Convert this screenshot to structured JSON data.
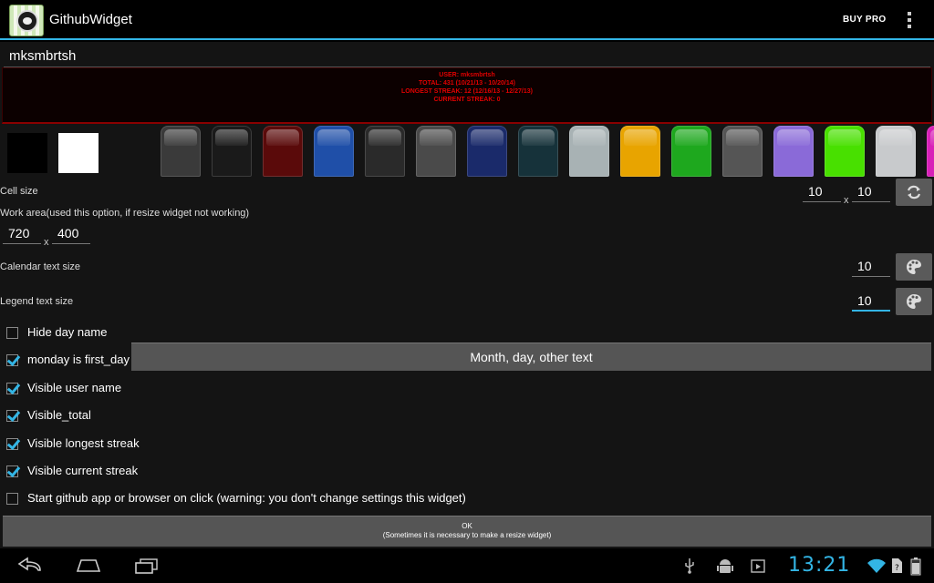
{
  "app": {
    "title": "GithubWidget",
    "buy_pro": "BUY PRO"
  },
  "username": "mksmbrtsh",
  "preview": {
    "user": "USER: mksmbrtsh",
    "total": "TOTAL: 431 (10/21/13 - 10/20/14)",
    "longest": "LONGEST STREAK: 12 (12/16/13 - 12/27/13)",
    "current": "CURRENT STREAK: 0"
  },
  "themes": [
    "#3a3a3a",
    "#1a1a1a",
    "#5a0a0a",
    "#1f4fa8",
    "#2a2a2a",
    "#4a4a4a",
    "#1a2a6a",
    "#16323a",
    "#a8b2b4",
    "#e8a400",
    "#1ea81e",
    "#555555",
    "#8a6ad8",
    "#48e000",
    "#c8cacc",
    "#d820b8"
  ],
  "cell_size": {
    "label": "Cell size",
    "width": "10",
    "x": "x",
    "height": "10"
  },
  "work_area": {
    "label": "Work area(used this option, if resize widget not working)",
    "width": "720",
    "x": "x",
    "height": "400"
  },
  "calendar_text": {
    "label": "Calendar text size",
    "value": "10"
  },
  "legend_text": {
    "label": "Legend text size",
    "value": "10"
  },
  "options": [
    {
      "label": "Hide day name",
      "checked": false
    },
    {
      "label": "monday is first_day",
      "checked": true
    },
    {
      "label": "Visible user name",
      "checked": true
    },
    {
      "label": "Visible_total",
      "checked": true
    },
    {
      "label": "Visible longest streak",
      "checked": true
    },
    {
      "label": "Visible current streak",
      "checked": true
    },
    {
      "label": "Start github app or browser on click (warning: you don't change settings this widget)",
      "checked": false
    }
  ],
  "month_button": "Month, day, other text",
  "ok_button": {
    "line1": "OK",
    "line2": "(Sometimes it is necessary to make a resize widget)"
  },
  "status": {
    "time": "13:21"
  },
  "colors": {
    "accent": "#33b5e5",
    "preview_text": "#e00000"
  }
}
